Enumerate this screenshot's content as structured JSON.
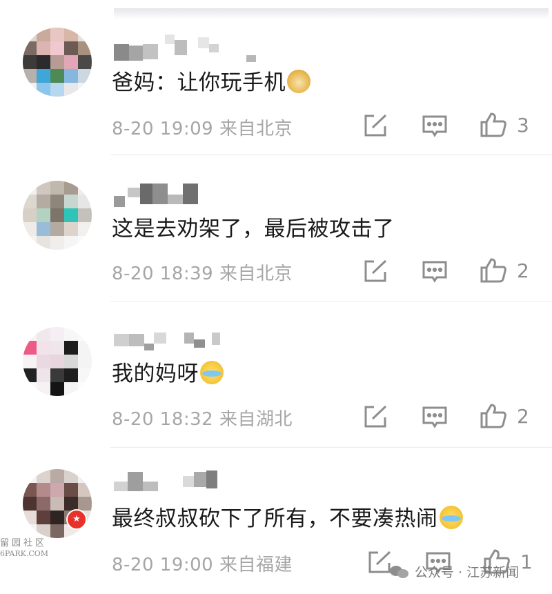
{
  "comments": [
    {
      "text": "爸妈：让你玩手机",
      "emoji": "doge-icon",
      "time": "8-20 19:09",
      "location": "来自北京",
      "likes": "3"
    },
    {
      "text": "这是去劝架了，最后被攻击了",
      "emoji": "",
      "time": "8-20 18:39",
      "location": "来自北京",
      "likes": "2"
    },
    {
      "text": "我的妈呀",
      "emoji": "laugh-cry-icon",
      "time": "8-20 18:32",
      "location": "来自湖北",
      "likes": "2"
    },
    {
      "text": "最终叔叔砍下了所有，不要凑热闹",
      "emoji": "laugh-cry-icon",
      "time": "8-20 19:00",
      "location": "来自福建",
      "likes": "1"
    }
  ],
  "watermarks": {
    "left_line1": "留园社区",
    "left_line2": "6PARK.COM",
    "right_text": "公众号 · 江苏新闻"
  },
  "colors": {
    "meta_gray": "#a6a6a6",
    "icon_gray": "#8d8d8d",
    "badge_red": "#e8312a"
  }
}
